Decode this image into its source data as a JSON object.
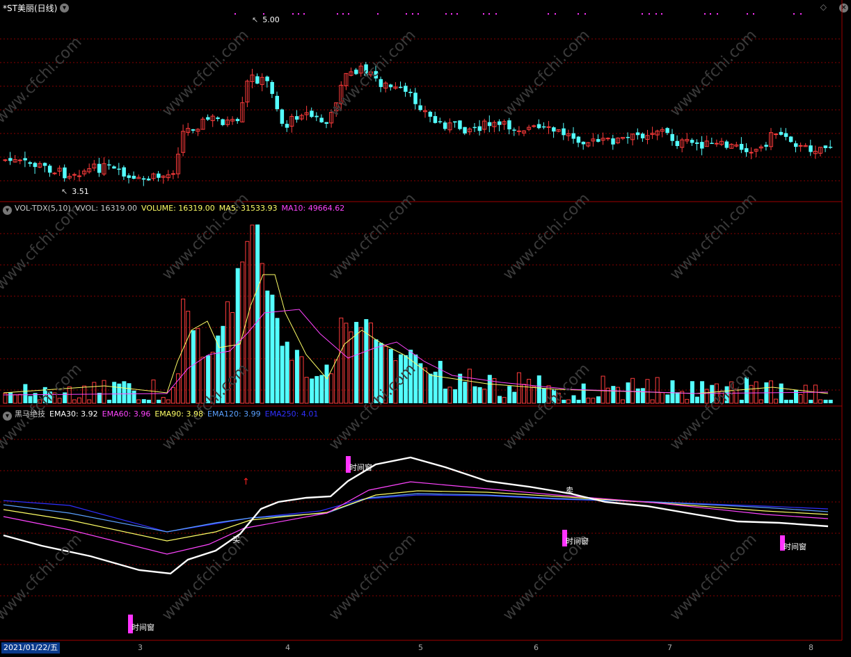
{
  "window": {
    "title": "*ST美丽(日线)",
    "menu_icon": "chevron-down-icon",
    "corner_icon": "diamond-icon"
  },
  "price_panel": {
    "high_label": "5.00",
    "low_label": "3.51",
    "watermark": "www.cfchi.com"
  },
  "volume_panel": {
    "indicator": "VOL-TDX(5,10)",
    "vvol": "VVOL: 16319.00",
    "volume": "VOLUME: 16319.00",
    "ma5": "MA5: 31533.93",
    "ma10": "MA10: 49664.62"
  },
  "ema_panel": {
    "indicator": "黑马绝技",
    "ema30": "EMA30: 3.92",
    "ema60": "EMA60: 3.96",
    "ema90": "EMA90: 3.98",
    "ema120": "EMA120: 3.99",
    "ema250": "EMA250: 4.01",
    "window_label": "时间窗",
    "buy_label": "买",
    "sell_label": "卖"
  },
  "date_axis": {
    "current": "2021/01/22/五",
    "months": [
      "3",
      "4",
      "5",
      "6",
      "7",
      "8"
    ]
  },
  "colors": {
    "up": "#ff3c3c",
    "down": "#54ffff",
    "grid": "#8a0000",
    "ma5": "#ffff66",
    "ma10": "#ff44ff",
    "ema30": "#ffffff",
    "ema60": "#ff44ff",
    "ema90": "#ffff66",
    "ema120": "#5aa0ff",
    "ema250": "#3030ff",
    "window_box": "#ff33ff"
  }
}
